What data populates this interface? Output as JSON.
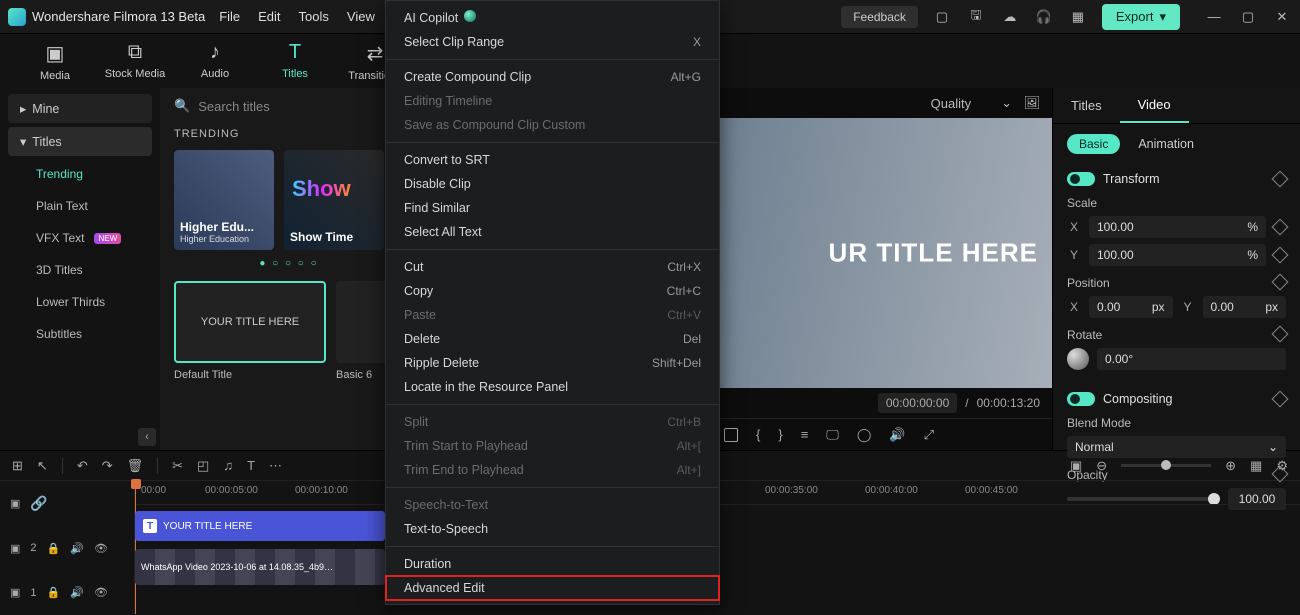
{
  "app": {
    "title": "Wondershare Filmora 13 Beta"
  },
  "topMenus": [
    "File",
    "Edit",
    "Tools",
    "View"
  ],
  "feedback": "Feedback",
  "export": "Export",
  "modes": [
    {
      "label": "Media",
      "active": false
    },
    {
      "label": "Stock Media",
      "active": false
    },
    {
      "label": "Audio",
      "active": false
    },
    {
      "label": "Titles",
      "active": true
    },
    {
      "label": "Transitions",
      "active": false
    }
  ],
  "sidebar": {
    "mine": "Mine",
    "titles": "Titles",
    "items": [
      {
        "label": "Trending",
        "active": true
      },
      {
        "label": "Plain Text"
      },
      {
        "label": "VFX Text",
        "new": true
      },
      {
        "label": "3D Titles"
      },
      {
        "label": "Lower Thirds"
      },
      {
        "label": "Subtitles"
      }
    ]
  },
  "browser": {
    "searchPlaceholder": "Search titles",
    "trending": "TRENDING",
    "thumbs": [
      {
        "label": "Higher Edu...",
        "sub": "Higher Education"
      },
      {
        "label": "Show Time",
        "big": "Show"
      }
    ],
    "defaults": [
      {
        "label": "YOUR TITLE HERE",
        "caption": "Default Title",
        "active": true
      },
      {
        "label": "",
        "caption": "Basic 6"
      }
    ]
  },
  "preview": {
    "quality": "Quality",
    "overlay": "UR TITLE HERE",
    "cur": "00:00:00:00",
    "total": "00:00:13:20"
  },
  "timeline": {
    "ruler": [
      "00:00",
      "00:00:05:00",
      "00:00:10:00",
      "00:00:35:00",
      "00:00:40:00",
      "00:00:45:00"
    ],
    "clipTitle": "YOUR TITLE HERE",
    "clipVideo": "WhatsApp Video 2023-10-06 at 14.08.35_4b9…"
  },
  "inspector": {
    "tabs": [
      "Titles",
      "Video"
    ],
    "pills": [
      "Basic",
      "Animation"
    ],
    "transform": "Transform",
    "scale": "Scale",
    "scaleX": "100.00",
    "scaleY": "100.00",
    "pct": "%",
    "position": "Position",
    "posX": "0.00",
    "posY": "0.00",
    "px": "px",
    "rotate": "Rotate",
    "rotVal": "0.00°",
    "compositing": "Compositing",
    "blend": "Blend Mode",
    "blendVal": "Normal",
    "opacity": "Opacity",
    "opVal": "100.00"
  },
  "context": [
    {
      "label": "AI Copilot",
      "copilot": true
    },
    {
      "label": "Select Clip Range",
      "sc": "X"
    },
    {
      "sep": true
    },
    {
      "label": "Create Compound Clip",
      "sc": "Alt+G"
    },
    {
      "label": "Editing Timeline",
      "disabled": true
    },
    {
      "label": "Save as Compound Clip Custom",
      "disabled": true
    },
    {
      "sep": true
    },
    {
      "label": "Convert to SRT"
    },
    {
      "label": "Disable Clip"
    },
    {
      "label": "Find Similar"
    },
    {
      "label": "Select All Text"
    },
    {
      "sep": true
    },
    {
      "label": "Cut",
      "sc": "Ctrl+X"
    },
    {
      "label": "Copy",
      "sc": "Ctrl+C"
    },
    {
      "label": "Paste",
      "sc": "Ctrl+V",
      "disabled": true
    },
    {
      "label": "Delete",
      "sc": "Del"
    },
    {
      "label": "Ripple Delete",
      "sc": "Shift+Del"
    },
    {
      "label": "Locate in the Resource Panel"
    },
    {
      "sep": true
    },
    {
      "label": "Split",
      "sc": "Ctrl+B",
      "disabled": true
    },
    {
      "label": "Trim Start to Playhead",
      "sc": "Alt+[",
      "disabled": true
    },
    {
      "label": "Trim End to Playhead",
      "sc": "Alt+]",
      "disabled": true
    },
    {
      "sep": true
    },
    {
      "label": "Speech-to-Text",
      "disabled": true
    },
    {
      "label": "Text-to-Speech"
    },
    {
      "sep": true
    },
    {
      "label": "Duration"
    },
    {
      "label": "Advanced Edit",
      "hl": true
    }
  ],
  "axes": {
    "x": "X",
    "y": "Y"
  }
}
